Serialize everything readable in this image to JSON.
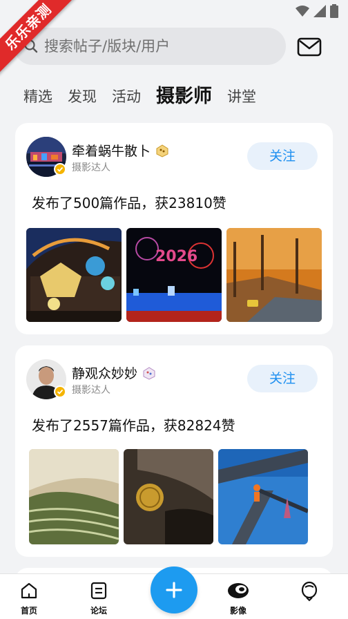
{
  "ribbon": {
    "text": "乐乐亲测"
  },
  "search": {
    "placeholder": "搜索帖子/版块/用户"
  },
  "tabs": [
    {
      "label": "精选"
    },
    {
      "label": "发现"
    },
    {
      "label": "活动"
    },
    {
      "label": "摄影师",
      "active": true
    },
    {
      "label": "讲堂"
    }
  ],
  "cards": [
    {
      "name": "牵着蜗牛散卜",
      "role": "摄影达人",
      "follow_label": "关注",
      "description": "发布了500篇作品，获23810赞"
    },
    {
      "name": "静观众妙妙",
      "role": "摄影达人",
      "follow_label": "关注",
      "description": "发布了2557篇作品，获82824赞"
    }
  ],
  "bottom_nav": {
    "home_label": "首页",
    "forum_label": "论坛",
    "image_label": "影像"
  },
  "colors": {
    "accent": "#1d8ff0",
    "follow_bg": "#e8f1fb",
    "ribbon": "#e02a2a",
    "verified": "#f5b400"
  }
}
